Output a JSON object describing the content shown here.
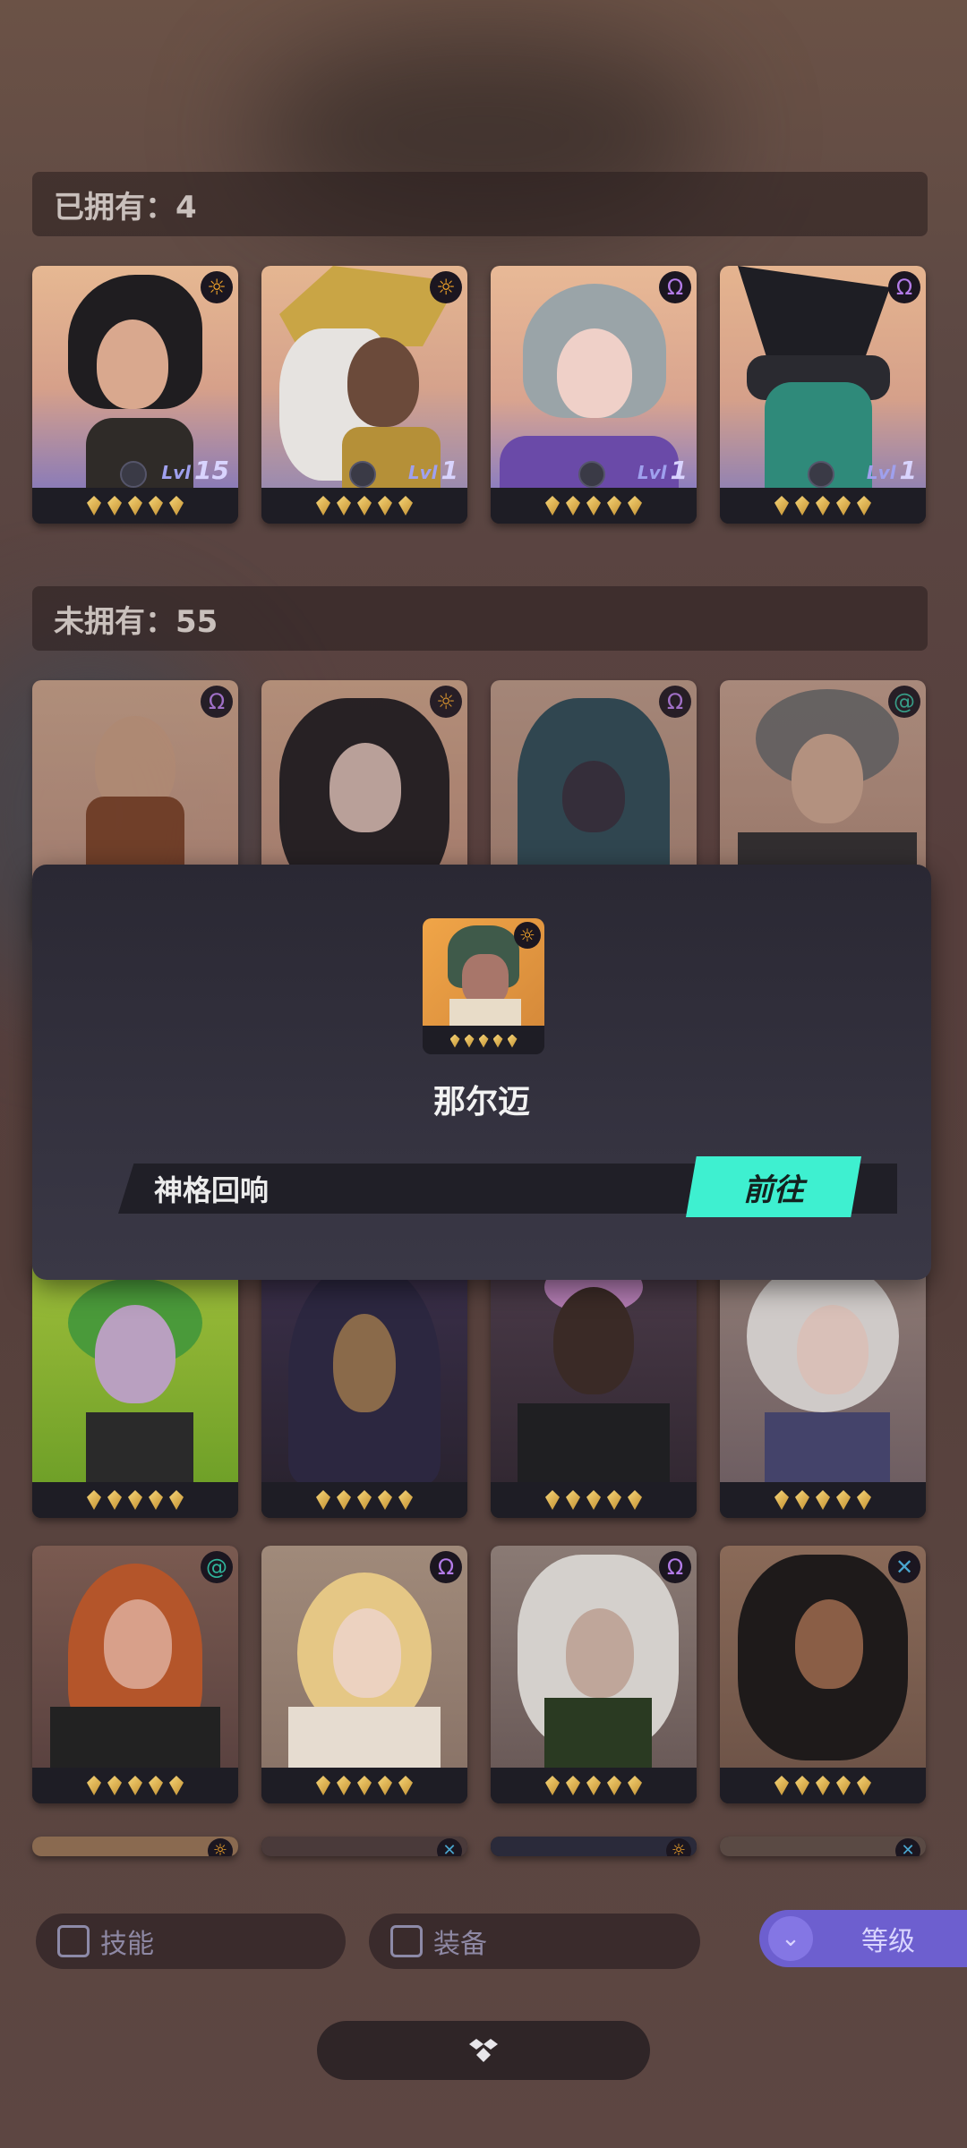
{
  "owned": {
    "header": "已拥有：4",
    "heroes": [
      {
        "class_icon": "sun-icon",
        "class_color": "#f4a52a",
        "level_prefix": "Lvl",
        "level": "15"
      },
      {
        "class_icon": "sun-icon",
        "class_color": "#f4a52a",
        "level_prefix": "Lvl",
        "level": "1"
      },
      {
        "class_icon": "omega-icon",
        "class_color": "#b37be8",
        "level_prefix": "Lvl",
        "level": "1"
      },
      {
        "class_icon": "omega-icon",
        "class_color": "#b37be8",
        "level_prefix": "Lvl",
        "level": "1"
      }
    ]
  },
  "unowned": {
    "header": "未拥有：55"
  },
  "modal": {
    "hero_name": "那尔迈",
    "source_label": "神格回响",
    "go_button": "前往"
  },
  "filters": {
    "skill_label": "技能",
    "equip_label": "装备",
    "sort_label": "等级"
  },
  "colors": {
    "accent_teal": "#3ef0d0",
    "sort_purple": "#6d5fcf",
    "star_gold": "#e8b84a"
  }
}
